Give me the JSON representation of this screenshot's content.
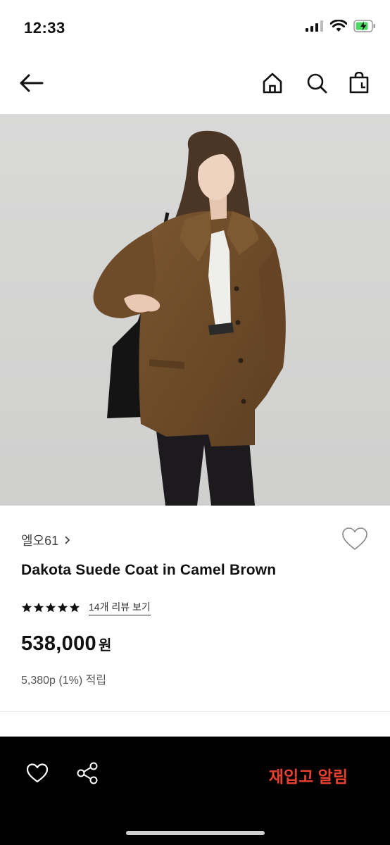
{
  "status": {
    "time": "12:33"
  },
  "nav": {
    "icons": [
      "back-arrow-icon",
      "home-icon",
      "search-icon",
      "shopping-bag-icon"
    ]
  },
  "product": {
    "brand": "엘오61",
    "name": "Dakota Suede Coat in Camel Brown",
    "rating_stars": 5,
    "review_link": "14개 리뷰 보기",
    "price": "538,000",
    "currency": "원",
    "points": "5,380p (1%) 적립"
  },
  "bottom_bar": {
    "restock_label": "재입고 알림",
    "restock_color": "#e8402e",
    "icons": [
      "heart-icon",
      "share-icon"
    ]
  }
}
